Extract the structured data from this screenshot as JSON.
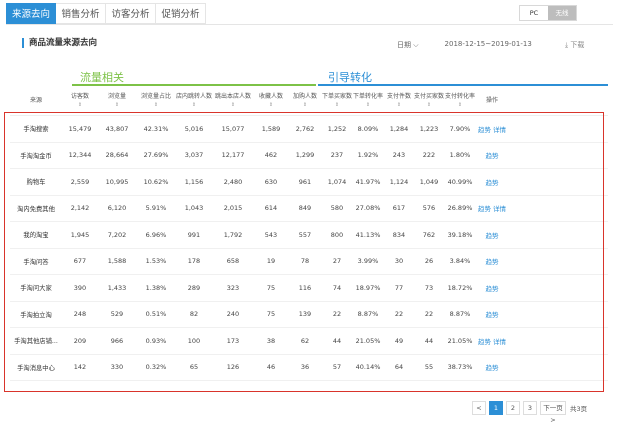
{
  "tabs": [
    "来源去向",
    "销售分析",
    "访客分析",
    "促销分析"
  ],
  "device": {
    "pc": "PC",
    "wireless": "无线"
  },
  "section_title": "商品流量来源去向",
  "date_granularity": "日期",
  "date_range": "2018-12-15~2019-01-13",
  "download": "下载",
  "groups": {
    "traffic": "流量相关",
    "conversion": "引导转化"
  },
  "headers": [
    "来源",
    "访客数",
    "浏览量",
    "浏览量占比",
    "店内跳转人数",
    "跳出本店人数",
    "收藏人数",
    "加购人数",
    "下单买家数",
    "下单转化率",
    "支付件数",
    "支付买家数",
    "支付转化率",
    "操作"
  ],
  "rows": [
    {
      "src": "手淘搜索",
      "v": [
        "15,479",
        "43,807",
        "42.31%",
        "5,016",
        "15,077",
        "1,589",
        "2,762",
        "1,252",
        "8.09%",
        "1,284",
        "1,223",
        "7.90%"
      ],
      "ops": [
        "趋势",
        "详情"
      ]
    },
    {
      "src": "手淘淘金币",
      "v": [
        "12,344",
        "28,664",
        "27.69%",
        "3,037",
        "12,177",
        "462",
        "1,299",
        "237",
        "1.92%",
        "243",
        "222",
        "1.80%"
      ],
      "ops": [
        "趋势"
      ]
    },
    {
      "src": "购物车",
      "v": [
        "2,559",
        "10,995",
        "10.62%",
        "1,156",
        "2,480",
        "630",
        "961",
        "1,074",
        "41.97%",
        "1,124",
        "1,049",
        "40.99%"
      ],
      "ops": [
        "趋势"
      ]
    },
    {
      "src": "淘内免费其他",
      "v": [
        "2,142",
        "6,120",
        "5.91%",
        "1,043",
        "2,015",
        "614",
        "849",
        "580",
        "27.08%",
        "617",
        "576",
        "26.89%"
      ],
      "ops": [
        "趋势",
        "详情"
      ]
    },
    {
      "src": "我的淘宝",
      "v": [
        "1,945",
        "7,202",
        "6.96%",
        "991",
        "1,792",
        "543",
        "557",
        "800",
        "41.13%",
        "834",
        "762",
        "39.18%"
      ],
      "ops": [
        "趋势"
      ]
    },
    {
      "src": "手淘问答",
      "v": [
        "677",
        "1,588",
        "1.53%",
        "178",
        "658",
        "19",
        "78",
        "27",
        "3.99%",
        "30",
        "26",
        "3.84%"
      ],
      "ops": [
        "趋势"
      ]
    },
    {
      "src": "手淘问大家",
      "v": [
        "390",
        "1,433",
        "1.38%",
        "289",
        "323",
        "75",
        "116",
        "74",
        "18.97%",
        "77",
        "73",
        "18.72%"
      ],
      "ops": [
        "趋势"
      ]
    },
    {
      "src": "手淘拍立淘",
      "v": [
        "248",
        "529",
        "0.51%",
        "82",
        "240",
        "75",
        "139",
        "22",
        "8.87%",
        "22",
        "22",
        "8.87%"
      ],
      "ops": [
        "趋势"
      ]
    },
    {
      "src": "手淘其他店铺...",
      "v": [
        "209",
        "966",
        "0.93%",
        "100",
        "173",
        "38",
        "62",
        "44",
        "21.05%",
        "49",
        "44",
        "21.05%"
      ],
      "ops": [
        "趋势",
        "详情"
      ]
    },
    {
      "src": "手淘消息中心",
      "v": [
        "142",
        "330",
        "0.32%",
        "65",
        "126",
        "46",
        "36",
        "57",
        "40.14%",
        "64",
        "55",
        "38.73%"
      ],
      "ops": [
        "趋势"
      ]
    }
  ],
  "pagination": {
    "prev": "<",
    "pages": [
      "1",
      "2",
      "3"
    ],
    "next": "下一页>",
    "total": "共3页"
  }
}
